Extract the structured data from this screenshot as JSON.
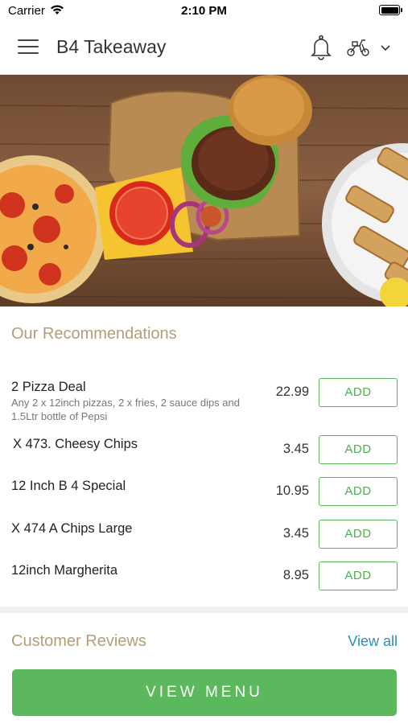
{
  "status_bar": {
    "carrier": "Carrier",
    "time": "2:10 PM"
  },
  "header": {
    "title": "B4 Takeaway",
    "icons": [
      "menu-icon",
      "bell-icon",
      "scooter-icon",
      "chevron-down-icon"
    ]
  },
  "recommendations": {
    "title": "Our Recommendations",
    "items": [
      {
        "name": "2 Pizza Deal",
        "description": "Any 2 x 12inch pizzas, 2 x fries, 2 sauce dips and 1.5Ltr bottle of Pepsi",
        "price": "22.99",
        "add_label": "ADD"
      },
      {
        "name": "X 473. Cheesy Chips",
        "description": "",
        "price": "3.45",
        "add_label": "ADD"
      },
      {
        "name": "12 Inch B 4 Special",
        "description": "",
        "price": "10.95",
        "add_label": "ADD"
      },
      {
        "name": "X 474 A Chips Large",
        "description": "",
        "price": "3.45",
        "add_label": "ADD"
      },
      {
        "name": "12inch Margherita",
        "description": "",
        "price": "8.95",
        "add_label": "ADD"
      }
    ]
  },
  "reviews": {
    "title": "Customer Reviews",
    "view_all_label": "View all"
  },
  "footer": {
    "view_menu_label": "VIEW MENU"
  },
  "colors": {
    "accent_green": "#5cb85c",
    "section_title": "#b0a07a",
    "link_blue": "#2a8fc4"
  }
}
